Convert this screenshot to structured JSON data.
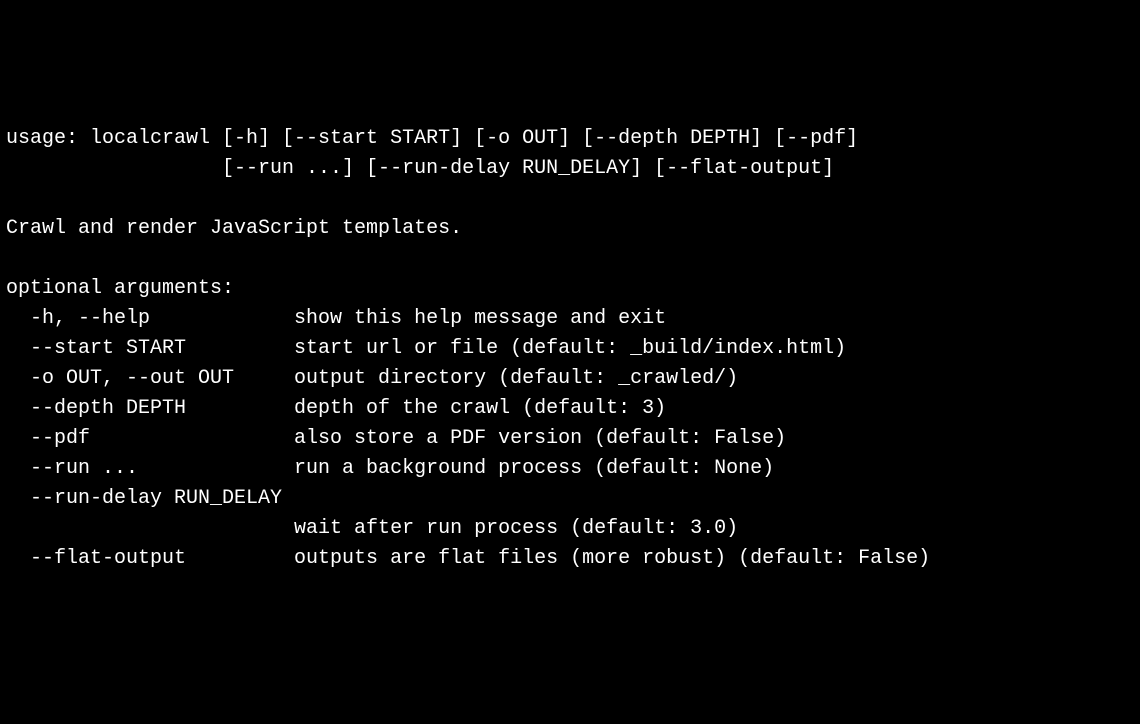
{
  "usage": {
    "line1": "usage: localcrawl [-h] [--start START] [-o OUT] [--depth DEPTH] [--pdf]",
    "line2": "                  [--run ...] [--run-delay RUN_DELAY] [--flat-output]"
  },
  "description": "Crawl and render JavaScript templates.",
  "section_header": "optional arguments:",
  "arguments": [
    {
      "flag": "  -h, --help",
      "desc": "show this help message and exit"
    },
    {
      "flag": "  --start START",
      "desc": "start url or file (default: _build/index.html)"
    },
    {
      "flag": "  -o OUT, --out OUT",
      "desc": "output directory (default: _crawled/)"
    },
    {
      "flag": "  --depth DEPTH",
      "desc": "depth of the crawl (default: 3)"
    },
    {
      "flag": "  --pdf",
      "desc": "also store a PDF version (default: False)"
    },
    {
      "flag": "  --run ...",
      "desc": "run a background process (default: None)"
    },
    {
      "flag": "  --run-delay RUN_DELAY",
      "desc_indent": "                        wait after run process (default: 3.0)"
    },
    {
      "flag": "  --flat-output",
      "desc": "outputs are flat files (more robust) (default: False)"
    }
  ],
  "lines": {
    "l1": "usage: localcrawl [-h] [--start START] [-o OUT] [--depth DEPTH] [--pdf]",
    "l2": "                  [--run ...] [--run-delay RUN_DELAY] [--flat-output]",
    "l3": "",
    "l4": "Crawl and render JavaScript templates.",
    "l5": "",
    "l6": "optional arguments:",
    "l7": "  -h, --help            show this help message and exit",
    "l8": "  --start START         start url or file (default: _build/index.html)",
    "l9": "  -o OUT, --out OUT     output directory (default: _crawled/)",
    "l10": "  --depth DEPTH         depth of the crawl (default: 3)",
    "l11": "  --pdf                 also store a PDF version (default: False)",
    "l12": "  --run ...             run a background process (default: None)",
    "l13": "  --run-delay RUN_DELAY",
    "l14": "                        wait after run process (default: 3.0)",
    "l15": "  --flat-output         outputs are flat files (more robust) (default: False)"
  }
}
